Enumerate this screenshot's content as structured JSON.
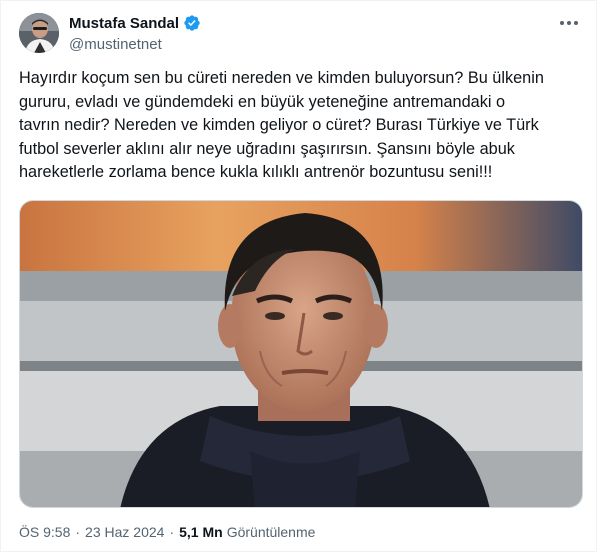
{
  "author": {
    "display_name": "Mustafa Sandal",
    "handle": "@mustinetnet",
    "verified": true,
    "avatar_icon": "profile-photo"
  },
  "tweet": {
    "text": "Hayırdır koçum sen bu cüreti nereden ve kimden buluyorsun? Bu ülkenin\ngururu, evladı ve gündemdeki en büyük yeteneğine antremandaki o\ntavrın nedir? Nereden ve kimden geliyor o cüret? Burası Türkiye ve Türk\nfutbol severler aklını alır neye uğradını şaşırırsın. Şansını böyle abuk\nhareketlerle zorlama bence kukla kılıklı antrenör bozuntusu seni!!!",
    "media_icon": "man-portrait-photo"
  },
  "meta": {
    "time": "ÖS 9:58",
    "separator": "·",
    "date": "23 Haz 2024",
    "views_count": "5,1 Mn",
    "views_label": "Görüntülenme"
  },
  "colors": {
    "verified_blue": "#1d9bf0",
    "text_primary": "#0f1419",
    "text_secondary": "#536471"
  },
  "icons": [
    "verified-badge-icon",
    "more-options-icon"
  ]
}
